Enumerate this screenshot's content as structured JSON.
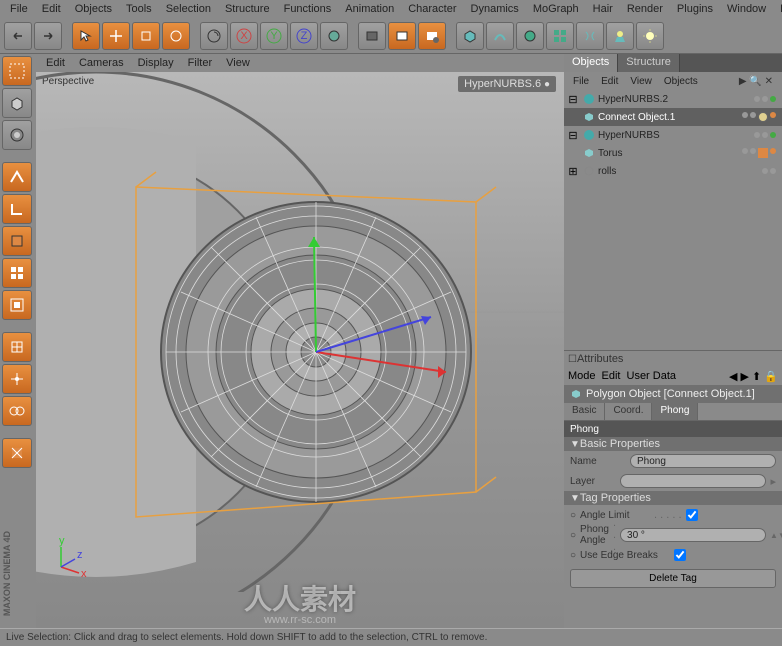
{
  "menubar": [
    "File",
    "Edit",
    "Objects",
    "Tools",
    "Selection",
    "Structure",
    "Functions",
    "Animation",
    "Character",
    "Dynamics",
    "MoGraph",
    "Hair",
    "Render",
    "Plugins",
    "Window",
    "Help"
  ],
  "viewport_menu": [
    "Edit",
    "Cameras",
    "Display",
    "Filter",
    "View"
  ],
  "viewport": {
    "label": "Perspective",
    "object_label": "HyperNURBS.6"
  },
  "panel_tabs": {
    "objects": "Objects",
    "structure": "Structure"
  },
  "panel_submenu": [
    "File",
    "Edit",
    "View",
    "Objects"
  ],
  "object_tree": [
    {
      "label": "HyperNURBS.2",
      "indent": 0,
      "expanded": true,
      "icon": "hypernurbs"
    },
    {
      "label": "Connect Object.1",
      "indent": 1,
      "icon": "polygon",
      "selected": true
    },
    {
      "label": "HyperNURBS",
      "indent": 0,
      "expanded": true,
      "icon": "hypernurbs"
    },
    {
      "label": "Torus",
      "indent": 1,
      "icon": "polygon"
    },
    {
      "label": "rolls",
      "indent": 0,
      "expanded": false,
      "icon": "null"
    }
  ],
  "attributes": {
    "header": "Attributes",
    "submenu": [
      "Mode",
      "Edit",
      "User Data"
    ],
    "title_icon": "polygon",
    "title": "Polygon Object [Connect Object.1]",
    "tabs": [
      "Basic",
      "Coord.",
      "Phong"
    ],
    "active_tab": "Phong",
    "section": "Phong",
    "subsection1": "Basic Properties",
    "name_label": "Name",
    "name_value": "Phong",
    "layer_label": "Layer",
    "layer_value": "",
    "subsection2": "Tag Properties",
    "angle_limit_label": "Angle Limit",
    "angle_limit_checked": true,
    "phong_angle_label": "Phong Angle",
    "phong_angle_value": "30 °",
    "edge_breaks_label": "Use Edge Breaks",
    "edge_breaks_checked": true,
    "delete_btn": "Delete Tag"
  },
  "statusbar": "Live Selection: Click and drag to select elements. Hold down SHIFT to add to the selection, CTRL to remove.",
  "logo": "MAXON CINEMA 4D",
  "watermark": "人人素材",
  "watermark_sub": "www.rr-sc.com"
}
